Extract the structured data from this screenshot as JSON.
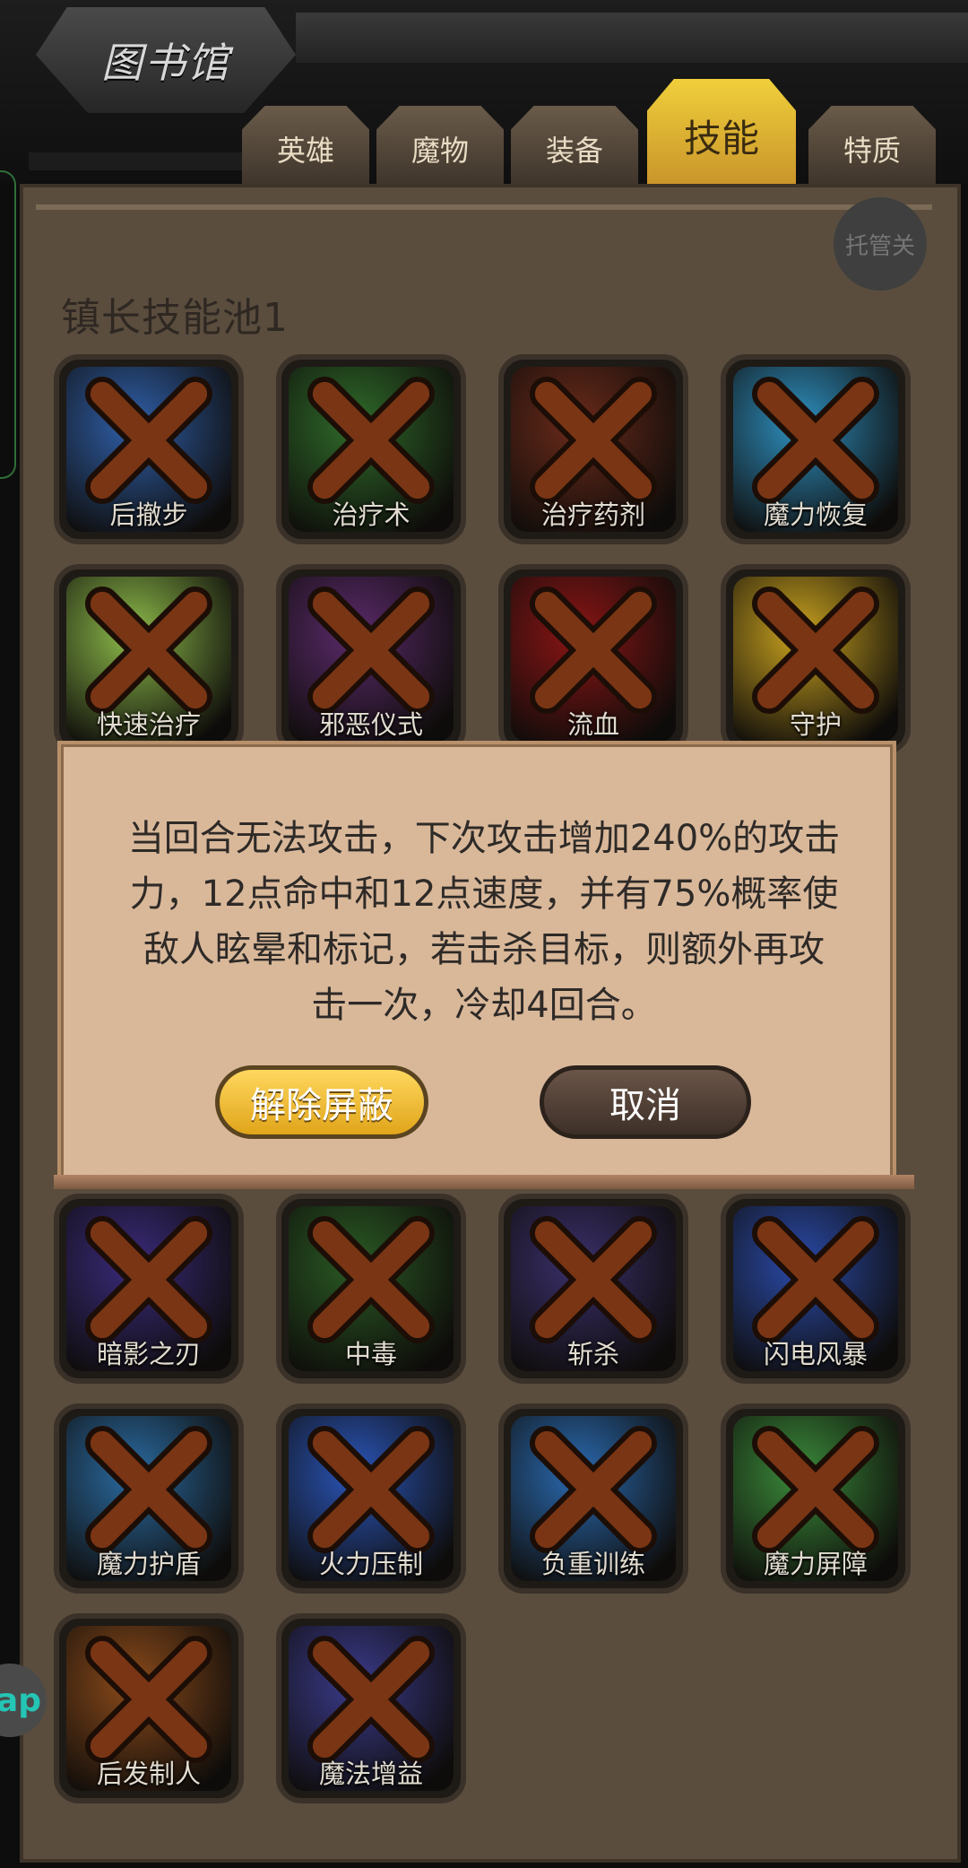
{
  "header": {
    "title": "图书馆"
  },
  "tabs": [
    {
      "label": "英雄"
    },
    {
      "label": "魔物"
    },
    {
      "label": "装备"
    },
    {
      "label": "技能",
      "active": true
    },
    {
      "label": "特质"
    }
  ],
  "panel": {
    "auto_button_label": "托管关",
    "section_title": "镇长技能池1"
  },
  "skills": [
    {
      "label": "后撤步",
      "blocked": true,
      "color": "#2f5fa8"
    },
    {
      "label": "治疗术",
      "blocked": true,
      "color": "#2f6b2a"
    },
    {
      "label": "治疗药剂",
      "blocked": true,
      "color": "#6a2a1a"
    },
    {
      "label": "魔力恢复",
      "blocked": true,
      "color": "#2e8fbf"
    },
    {
      "label": "快速治疗",
      "blocked": true,
      "color": "#8dbb4a"
    },
    {
      "label": "邪恶仪式",
      "blocked": true,
      "color": "#5a2a6a"
    },
    {
      "label": "流血",
      "blocked": true,
      "color": "#8a1515"
    },
    {
      "label": "守护",
      "blocked": true,
      "color": "#c9a21f"
    },
    {
      "label": "暗影之刃",
      "blocked": true,
      "color": "#3a2a7a"
    },
    {
      "label": "中毒",
      "blocked": true,
      "color": "#2a5a24"
    },
    {
      "label": "斩杀",
      "blocked": true,
      "color": "#3a2f6a"
    },
    {
      "label": "闪电风暴",
      "blocked": true,
      "color": "#2a4aa8"
    },
    {
      "label": "魔力护盾",
      "blocked": true,
      "color": "#2a6aa0"
    },
    {
      "label": "火力压制",
      "blocked": true,
      "color": "#2a55b8"
    },
    {
      "label": "负重训练",
      "blocked": true,
      "color": "#2a6ab0"
    },
    {
      "label": "魔力屏障",
      "blocked": true,
      "color": "#3a8a3a"
    },
    {
      "label": "后发制人",
      "blocked": true,
      "color": "#8a4a1a"
    },
    {
      "label": "魔法增益",
      "blocked": true,
      "color": "#3a3a8a"
    }
  ],
  "dialog": {
    "text_line1": "当回合无法攻击，下次攻击增加240%的攻击",
    "text_line2": "力，12点命中和12点速度，并有75%概率使",
    "text_line3": "敌人眩晕和标记，若击杀目标，则额外再攻",
    "text_line4": "击一次，冷却4回合。",
    "confirm_label": "解除屏蔽",
    "cancel_label": "取消"
  },
  "floating_button_label": "ap"
}
